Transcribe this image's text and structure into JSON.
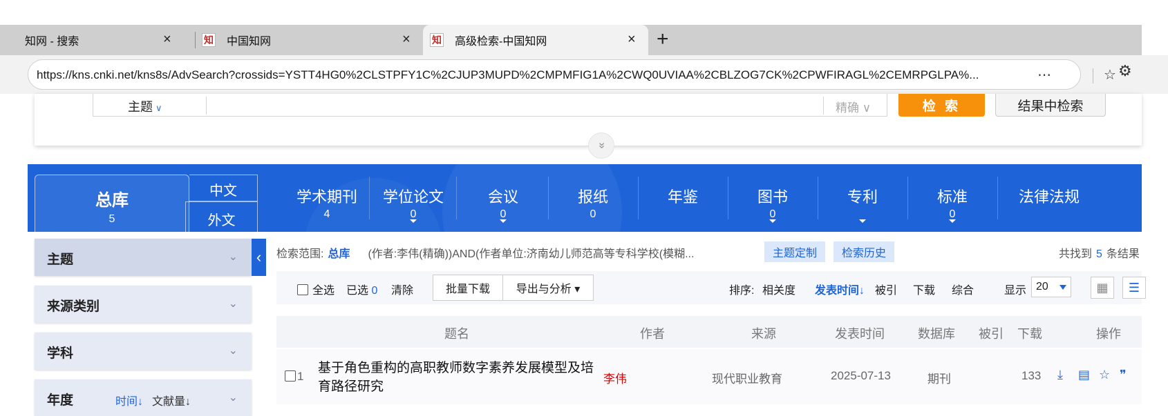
{
  "browser": {
    "tabs": [
      {
        "label": "知网 - 搜索",
        "close": "×"
      },
      {
        "label": "中国知网",
        "favicon": "知",
        "close": "×"
      },
      {
        "label": "高级检索-中国知网",
        "favicon": "知",
        "close": "×"
      }
    ],
    "new_tab": "+",
    "url": "https://kns.cnki.net/kns8s/AdvSearch?crossids=YSTT4HG0%2CLSTPFY1C%2CJUP3MUPD%2CMPMFIG1A%2CWQ0UVIAA%2CBLZOG7CK%2CPWFIRAGL%2CEMRPGLPA%...",
    "icons": {
      "more": "⋯",
      "favorite": "☆",
      "extensions": "⚙"
    }
  },
  "search": {
    "field_type": "主题",
    "match_mode": "精确 ∨",
    "search_button": "检 索",
    "refine_button": "结果中检索",
    "expand_icon": "»"
  },
  "db_nav": {
    "main": {
      "name": "总库",
      "count": "5"
    },
    "lang_zh": "中文",
    "lang_en": "外文",
    "items": [
      {
        "name": "学术期刊",
        "count": "4"
      },
      {
        "name": "学位论文",
        "count": "0"
      },
      {
        "name": "会议",
        "count": "0"
      },
      {
        "name": "报纸",
        "count": "0"
      },
      {
        "name": "年鉴",
        "count": ""
      },
      {
        "name": "图书",
        "count": "0"
      },
      {
        "name": "专利",
        "count": ""
      },
      {
        "name": "标准",
        "count": "0"
      },
      {
        "name": "法律法规",
        "count": ""
      }
    ]
  },
  "facets": [
    {
      "title": "主题"
    },
    {
      "title": "来源类别"
    },
    {
      "title": "学科"
    },
    {
      "title": "年度",
      "sort_time": "时间↓",
      "sort_count": "文献量↓"
    }
  ],
  "facet_chevron": "⌄",
  "collapse_icon": "‹",
  "scope": {
    "label": "检索范围:",
    "db": "总库",
    "query": "(作者:李伟(精确))AND(作者单位:济南幼儿师范高等专科学校(模糊...",
    "tag_theme": "主题定制",
    "tag_history": "检索历史",
    "found_prefix": "共找到",
    "found_count": "5",
    "found_suffix": "条结果"
  },
  "toolbar": {
    "select_all": "全选",
    "selected_label": "已选",
    "selected_count": "0",
    "clear": "清除",
    "batch_download": "批量下载",
    "export": "导出与分析 ▾",
    "sort_label": "排序:",
    "sort_relevance": "相关度",
    "sort_date": "发表时间↓",
    "sort_cited": "被引",
    "sort_download": "下载",
    "sort_overall": "综合",
    "display_label": "显示",
    "display_value": "20",
    "view_grid": "▦",
    "view_list": "☰"
  },
  "table": {
    "headers": {
      "title": "题名",
      "author": "作者",
      "source": "来源",
      "date": "发表时间",
      "db": "数据库",
      "cited": "被引",
      "downloads": "下载",
      "ops": "操作"
    },
    "rows": [
      {
        "index": "1",
        "title": "基于角色重构的高职教师数字素养发展模型及培育路径研究",
        "author": "李伟",
        "source": "现代职业教育",
        "date": "2025-07-13",
        "db": "期刊",
        "cited": "",
        "downloads": "133",
        "op_icons": {
          "download": "⤓",
          "read": "▤",
          "favorite": "☆",
          "quote": "❞"
        }
      }
    ]
  },
  "colors": {
    "brand_blue": "#1e64d8",
    "search_orange": "#f7900a",
    "author_red": "#e00000"
  }
}
